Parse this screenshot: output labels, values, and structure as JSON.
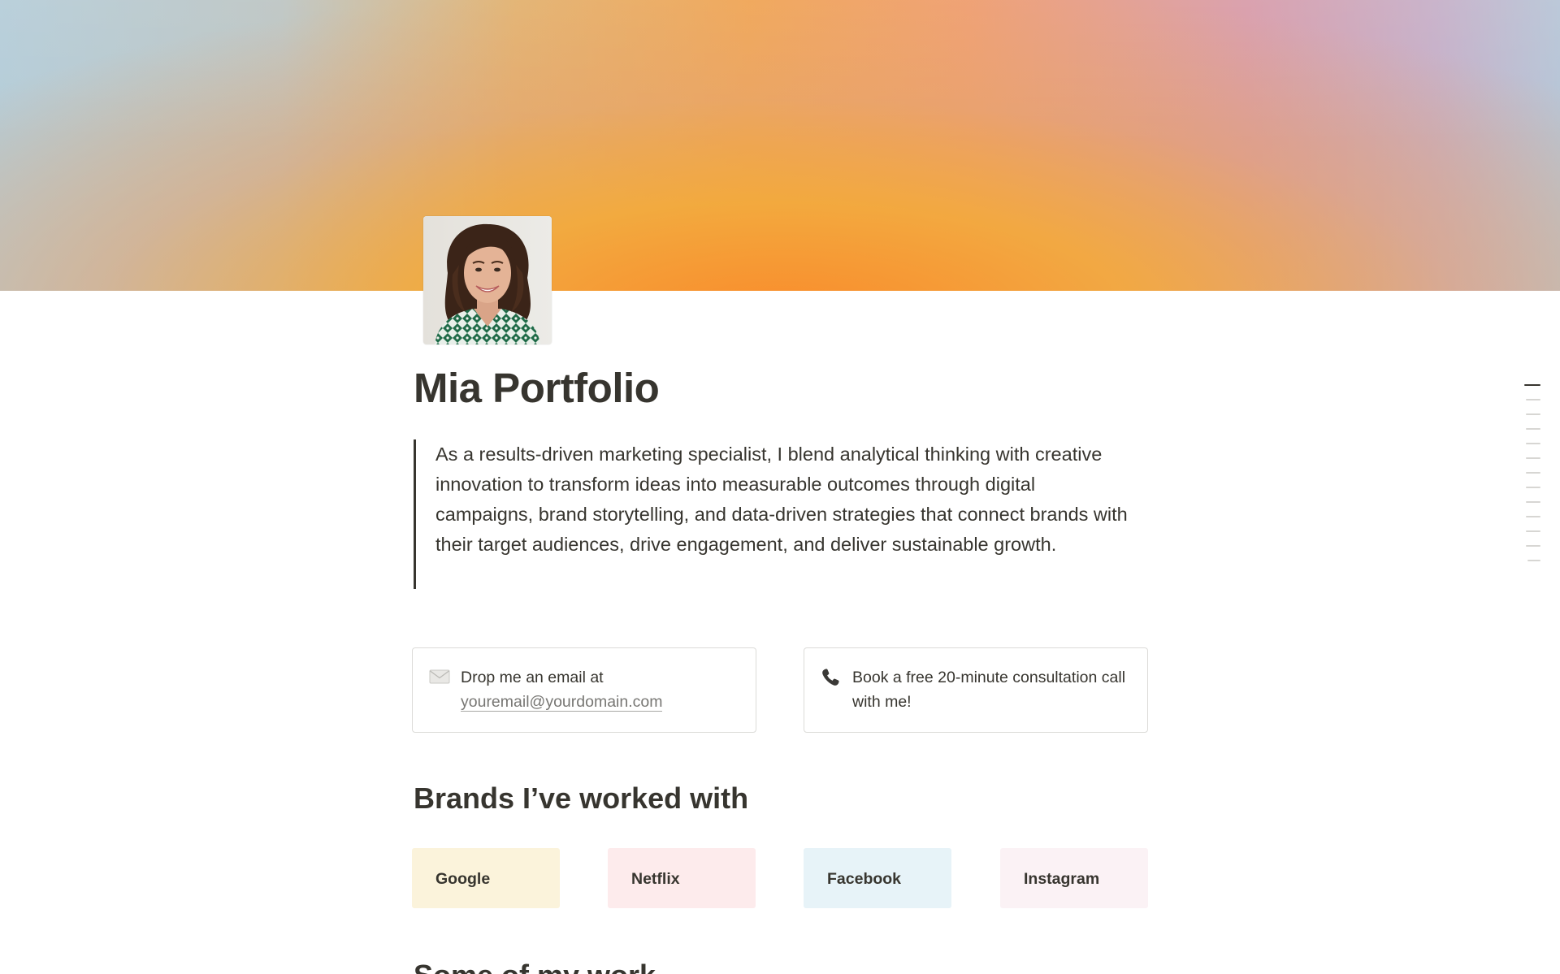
{
  "page": {
    "title": "Mia Portfolio",
    "quote": "As a results-driven marketing specialist, I blend analytical thinking with creative innovation to transform ideas into measurable outcomes through digital campaigns, brand storytelling, and data-driven strategies that connect brands with their target audiences, drive engagement, and deliver sustainable growth."
  },
  "callouts": {
    "email": {
      "icon": "envelope-icon",
      "text": "Drop me an email at",
      "link": "youremail@yourdomain.com"
    },
    "phone": {
      "icon": "phone-icon",
      "text": "Book a free 20-minute consultation call with me!"
    }
  },
  "brands": {
    "heading": "Brands I’ve worked with",
    "items": [
      {
        "label": "Google",
        "bg": "#fbf3db"
      },
      {
        "label": "Netflix",
        "bg": "#fdebec"
      },
      {
        "label": "Facebook",
        "bg": "#e7f3f8"
      },
      {
        "label": "Instagram",
        "bg": "#fbf2f5"
      }
    ]
  },
  "next_section": {
    "heading": "Some of my work"
  },
  "colors": {
    "text": "#37352f",
    "border": "#dcdbd8",
    "muted": "#787774"
  },
  "toc": {
    "count": 13,
    "active_index": 0
  }
}
